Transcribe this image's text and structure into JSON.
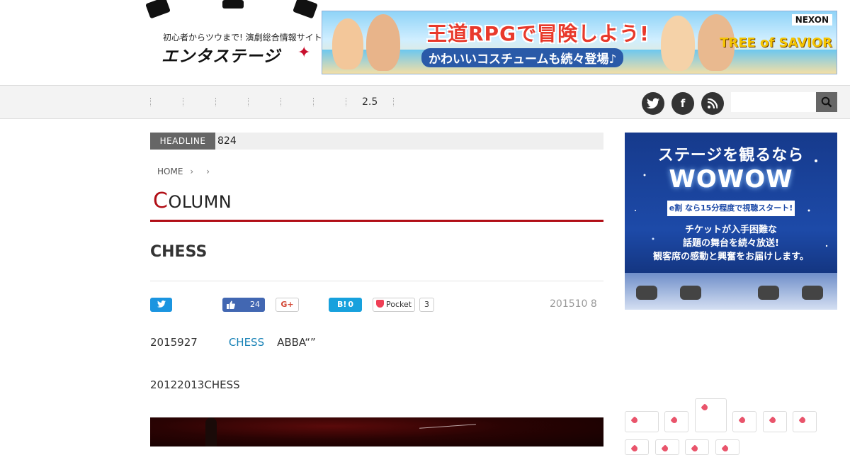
{
  "header": {
    "logo": {
      "tagline": "初心者からツウまで! 演劇総合情報サイト",
      "name": "エンタステージ"
    },
    "banner": {
      "headline": "王道RPGで冒険しよう!",
      "subline": "かわいいコスチュームも続々登場♪",
      "brand": "NEXON",
      "game": "TREE of SAVIOR"
    }
  },
  "nav": {
    "items": [
      "2.5"
    ],
    "social": [
      {
        "icon": "twitter-icon",
        "glyph": "t"
      },
      {
        "icon": "facebook-icon",
        "glyph": "f"
      },
      {
        "icon": "rss-icon",
        "glyph": "≋"
      }
    ],
    "search": {
      "placeholder": "",
      "button_icon": "search-icon"
    }
  },
  "headline": {
    "tag": "HEADLINE",
    "text": "824"
  },
  "breadcrumb": {
    "home": "HOME",
    "chevron": "›"
  },
  "section": {
    "title_cap": "C",
    "title_rest": "OLUMN"
  },
  "article": {
    "title": "CHESS",
    "share": {
      "twitter_icon": "twitter-icon",
      "fb_like_count": "24",
      "gplus_label": "G+",
      "hatena_label": "B!",
      "hatena_count": "0",
      "pocket_label": "Pocket",
      "pocket_count": "3"
    },
    "date": "201510 8",
    "para1_before": "2015927",
    "para1_link": "CHESS",
    "para1_after": "ABBA“”",
    "para2": "20122013CHESS"
  },
  "sidebar": {
    "ad": {
      "line1": "ステージを観るなら",
      "line2": "WOWOW",
      "pill": "e割 なら15分程度で視聴スタート!",
      "body": [
        "チケットが入手困難な",
        "話題の舞台を続々放送!",
        "観客席の感動と興奮をお届けします。"
      ]
    },
    "tags_icon": "tag-icon"
  },
  "colors": {
    "accent": "#b10e16",
    "link": "#1a83b7",
    "twitter": "#1b95e0",
    "facebook": "#4267b2",
    "hatena": "#17a1dd",
    "pocket": "#ef4056"
  }
}
